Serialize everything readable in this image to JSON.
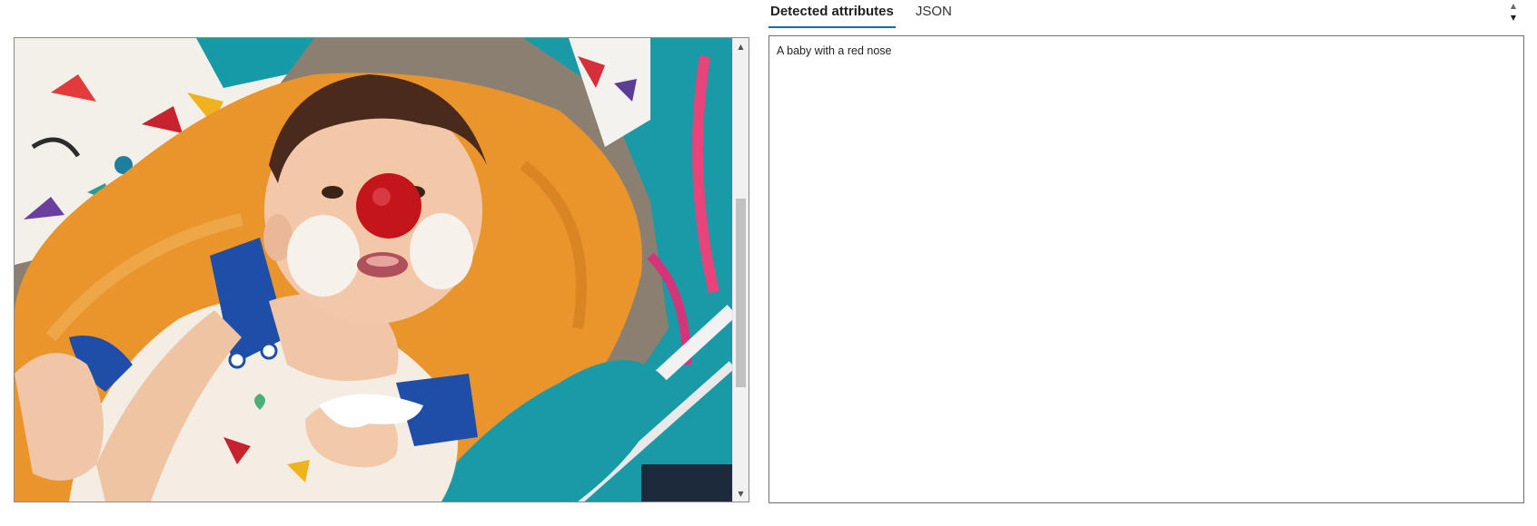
{
  "tabs": [
    {
      "label": "Detected attributes",
      "active": true
    },
    {
      "label": "JSON",
      "active": false
    }
  ],
  "result": {
    "caption": "A baby with a red nose"
  },
  "image": {
    "alt": "Photo of a baby wearing a red clown nose, sitting in a baby seat"
  },
  "colors": {
    "accent": "#0f6cbd",
    "border": "#8a8a8a"
  },
  "icons": {
    "scroll_up": "chevron-up-icon",
    "scroll_down": "chevron-down-icon"
  }
}
